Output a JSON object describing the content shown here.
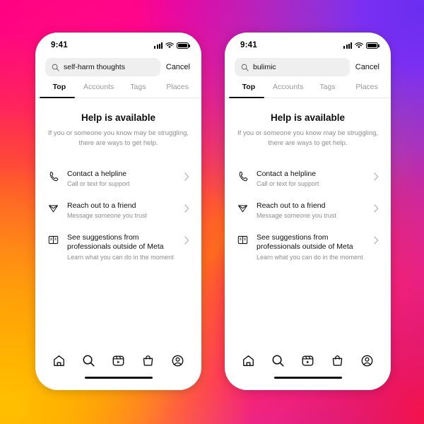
{
  "background": {
    "gradient_stops": [
      "#ff0080",
      "#ff4a3d",
      "#ff9500",
      "#ffc000",
      "#f5124a",
      "#e62fb0",
      "#7b2ff2"
    ],
    "description": "Instagram brand gradient"
  },
  "phones": [
    {
      "id": "phone-left",
      "status_bar": {
        "time": "9:41",
        "signal_icon": "cellular-signal-icon",
        "wifi_icon": "wifi-icon",
        "battery_icon": "battery-icon"
      },
      "search": {
        "icon": "search-icon",
        "value": "self-harm thoughts",
        "placeholder": "Search",
        "cancel_label": "Cancel"
      },
      "tabs": [
        {
          "label": "Top",
          "active": true
        },
        {
          "label": "Accounts",
          "active": false
        },
        {
          "label": "Tags",
          "active": false
        },
        {
          "label": "Places",
          "active": false
        }
      ],
      "hero": {
        "title": "Help is available",
        "subtitle_line1": "If you or someone you know may be struggling,",
        "subtitle_line2": "there are ways to get help."
      },
      "options": [
        {
          "icon": "phone-handset-icon",
          "title": "Contact a helpline",
          "subtitle": "Call or text for support",
          "chevron": "chevron-right-icon"
        },
        {
          "icon": "paper-plane-icon",
          "title": "Reach out to a friend",
          "subtitle": "Message someone you trust",
          "chevron": "chevron-right-icon"
        },
        {
          "icon": "open-book-icon",
          "title": "See suggestions from professionals outside of Meta",
          "subtitle": "Learn what you can do in the moment",
          "chevron": "chevron-right-icon"
        }
      ],
      "bottom_nav": [
        {
          "icon": "home-icon",
          "label": "Home",
          "active": false
        },
        {
          "icon": "search-icon",
          "label": "Search",
          "active": true
        },
        {
          "icon": "reels-icon",
          "label": "Reels",
          "active": false
        },
        {
          "icon": "shop-bag-icon",
          "label": "Shop",
          "active": false
        },
        {
          "icon": "profile-icon",
          "label": "Profile",
          "active": false
        }
      ]
    },
    {
      "id": "phone-right",
      "status_bar": {
        "time": "9:41",
        "signal_icon": "cellular-signal-icon",
        "wifi_icon": "wifi-icon",
        "battery_icon": "battery-icon"
      },
      "search": {
        "icon": "search-icon",
        "value": "bulimic",
        "placeholder": "Search",
        "cancel_label": "Cancel"
      },
      "tabs": [
        {
          "label": "Top",
          "active": true
        },
        {
          "label": "Accounts",
          "active": false
        },
        {
          "label": "Tags",
          "active": false
        },
        {
          "label": "Places",
          "active": false
        }
      ],
      "hero": {
        "title": "Help is available",
        "subtitle_line1": "If you or someone you know may be struggling,",
        "subtitle_line2": "there are ways to get help."
      },
      "options": [
        {
          "icon": "phone-handset-icon",
          "title": "Contact a helpline",
          "subtitle": "Call or text for support",
          "chevron": "chevron-right-icon"
        },
        {
          "icon": "paper-plane-icon",
          "title": "Reach out to a friend",
          "subtitle": "Message someone you trust",
          "chevron": "chevron-right-icon"
        },
        {
          "icon": "open-book-icon",
          "title": "See suggestions from professionals outside of Meta",
          "subtitle": "Learn what you can do in the moment",
          "chevron": "chevron-right-icon"
        }
      ],
      "bottom_nav": [
        {
          "icon": "home-icon",
          "label": "Home",
          "active": false
        },
        {
          "icon": "search-icon",
          "label": "Search",
          "active": true
        },
        {
          "icon": "reels-icon",
          "label": "Reels",
          "active": false
        },
        {
          "icon": "shop-bag-icon",
          "label": "Shop",
          "active": false
        },
        {
          "icon": "profile-icon",
          "label": "Profile",
          "active": false
        }
      ]
    }
  ]
}
